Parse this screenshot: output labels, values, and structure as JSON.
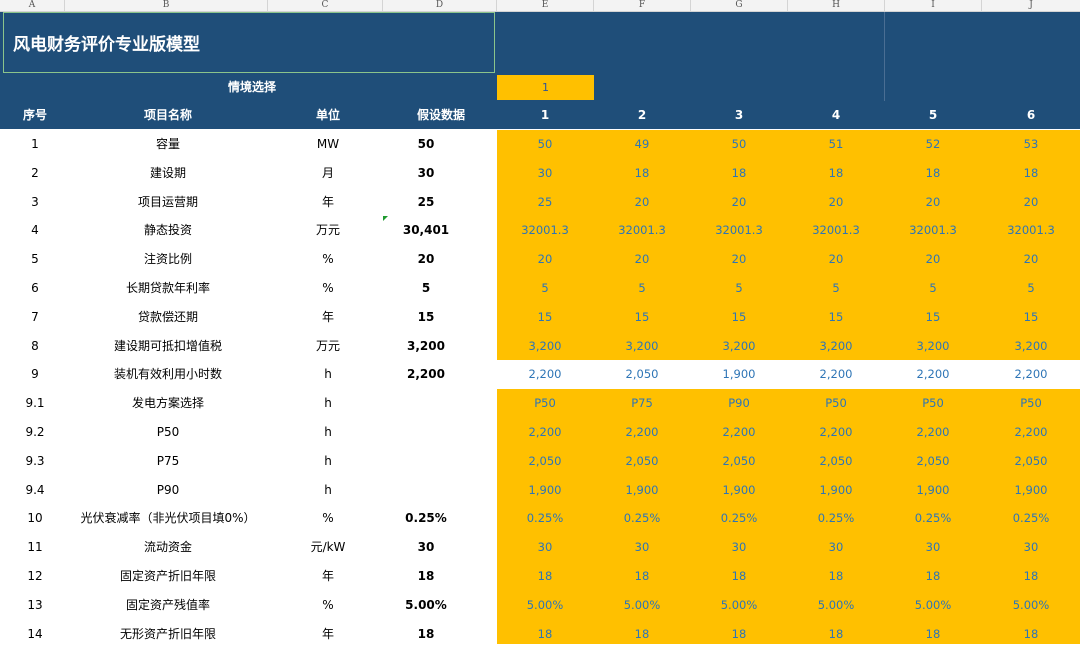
{
  "columns": [
    "A",
    "B",
    "C",
    "D",
    "E",
    "F",
    "G",
    "H",
    "I",
    "J"
  ],
  "title": "风电财务评价专业版模型",
  "scenario_label": "情境选择",
  "scenario_value": "1",
  "headers": {
    "seq": "序号",
    "name": "项目名称",
    "unit": "单位",
    "assumed": "假设数据",
    "scenarios": [
      "1",
      "2",
      "3",
      "4",
      "5",
      "6"
    ]
  },
  "rows": [
    {
      "seq": "1",
      "name": "容量",
      "unit": "MW",
      "val": "50",
      "s": [
        "50",
        "49",
        "50",
        "51",
        "52",
        "53"
      ]
    },
    {
      "seq": "2",
      "name": "建设期",
      "unit": "月",
      "val": "30",
      "s": [
        "30",
        "18",
        "18",
        "18",
        "18",
        "18"
      ]
    },
    {
      "seq": "3",
      "name": "项目运营期",
      "unit": "年",
      "val": "25",
      "s": [
        "25",
        "20",
        "20",
        "20",
        "20",
        "20"
      ]
    },
    {
      "seq": "4",
      "name": "静态投资",
      "unit": "万元",
      "val": "30,401",
      "s": [
        "32001.3",
        "32001.3",
        "32001.3",
        "32001.3",
        "32001.3",
        "32001.3"
      ]
    },
    {
      "seq": "5",
      "name": "注资比例",
      "unit": "%",
      "val": "20",
      "s": [
        "20",
        "20",
        "20",
        "20",
        "20",
        "20"
      ]
    },
    {
      "seq": "6",
      "name": "长期贷款年利率",
      "unit": "%",
      "val": "5",
      "s": [
        "5",
        "5",
        "5",
        "5",
        "5",
        "5"
      ]
    },
    {
      "seq": "7",
      "name": "贷款偿还期",
      "unit": "年",
      "val": "15",
      "s": [
        "15",
        "15",
        "15",
        "15",
        "15",
        "15"
      ]
    },
    {
      "seq": "8",
      "name": "建设期可抵扣增值税",
      "unit": "万元",
      "val": "3,200",
      "s": [
        "3,200",
        "3,200",
        "3,200",
        "3,200",
        "3,200",
        "3,200"
      ]
    },
    {
      "seq": "9",
      "name": "装机有效利用小时数",
      "unit": "h",
      "val": "2,200",
      "s": [
        "2,200",
        "2,050",
        "1,900",
        "2,200",
        "2,200",
        "2,200"
      ]
    },
    {
      "seq": "9.1",
      "name": "发电方案选择",
      "unit": "h",
      "val": "",
      "s": [
        "P50",
        "P75",
        "P90",
        "P50",
        "P50",
        "P50"
      ]
    },
    {
      "seq": "9.2",
      "name": "P50",
      "unit": "h",
      "val": "",
      "s": [
        "2,200",
        "2,200",
        "2,200",
        "2,200",
        "2,200",
        "2,200"
      ]
    },
    {
      "seq": "9.3",
      "name": "P75",
      "unit": "h",
      "val": "",
      "s": [
        "2,050",
        "2,050",
        "2,050",
        "2,050",
        "2,050",
        "2,050"
      ]
    },
    {
      "seq": "9.4",
      "name": "P90",
      "unit": "h",
      "val": "",
      "s": [
        "1,900",
        "1,900",
        "1,900",
        "1,900",
        "1,900",
        "1,900"
      ]
    },
    {
      "seq": "10",
      "name": "光伏衰减率（非光伏项目填0%）",
      "unit": "%",
      "val": "0.25%",
      "s": [
        "0.25%",
        "0.25%",
        "0.25%",
        "0.25%",
        "0.25%",
        "0.25%"
      ]
    },
    {
      "seq": "11",
      "name": "流动资金",
      "unit": "元/kW",
      "val": "30",
      "s": [
        "30",
        "30",
        "30",
        "30",
        "30",
        "30"
      ]
    },
    {
      "seq": "12",
      "name": "固定资产折旧年限",
      "unit": "年",
      "val": "18",
      "s": [
        "18",
        "18",
        "18",
        "18",
        "18",
        "18"
      ]
    },
    {
      "seq": "13",
      "name": "固定资产残值率",
      "unit": "%",
      "val": "5.00%",
      "s": [
        "5.00%",
        "5.00%",
        "5.00%",
        "5.00%",
        "5.00%",
        "5.00%"
      ]
    },
    {
      "seq": "14",
      "name": "无形资产折旧年限",
      "unit": "年",
      "val": "18",
      "s": [
        "18",
        "18",
        "18",
        "18",
        "18",
        "18"
      ]
    }
  ]
}
